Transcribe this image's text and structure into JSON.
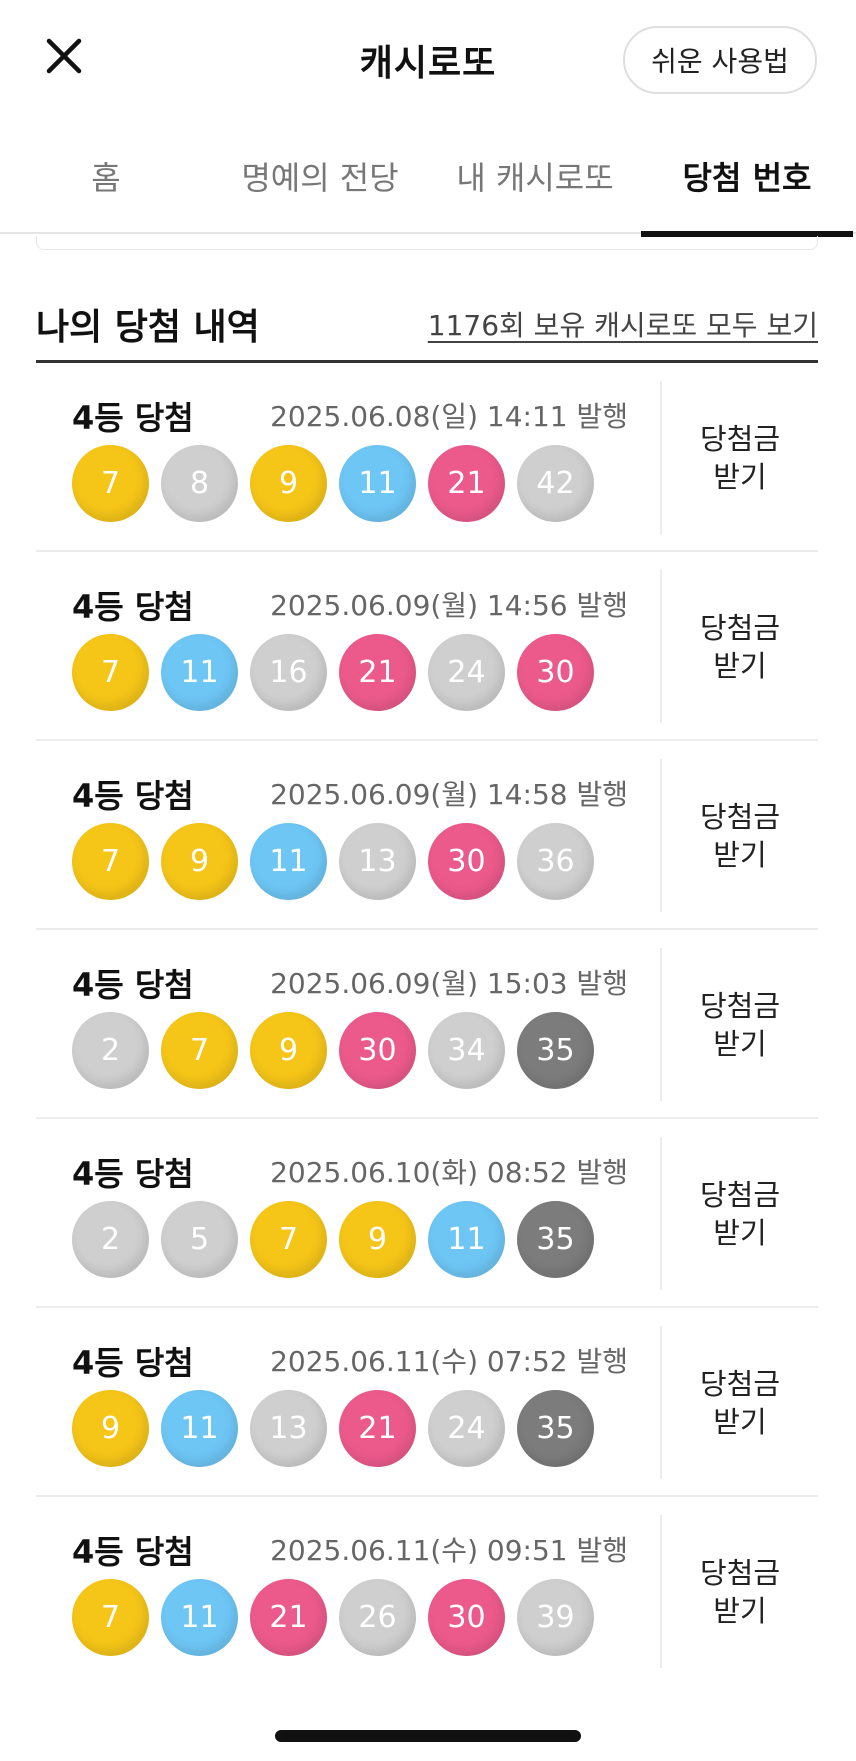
{
  "header": {
    "close_icon": "close-icon",
    "title": "캐시로또",
    "guide_label": "쉬운 사용법"
  },
  "tabs": [
    {
      "label": "홈",
      "active": false
    },
    {
      "label": "명예의 전당",
      "active": false
    },
    {
      "label": "내 캐시로또",
      "active": false
    },
    {
      "label": "당첨 번호",
      "active": true
    }
  ],
  "section": {
    "title": "나의 당첨 내역",
    "view_all_label": "1176회 보유 캐시로또 모두 보기"
  },
  "ball_colors": {
    "yellow": "#f5c518",
    "blue": "#6ec6f5",
    "pink": "#ec5a8c",
    "gray": "#cfcfcf",
    "dark": "#7c7c7c"
  },
  "entries": [
    {
      "rank": "4등 당첨",
      "date": "2025.06.08(일) 14:11 발행",
      "claim_line1": "당첨금",
      "claim_line2": "받기",
      "balls": [
        {
          "num": "7",
          "color": "yellow"
        },
        {
          "num": "8",
          "color": "gray"
        },
        {
          "num": "9",
          "color": "yellow"
        },
        {
          "num": "11",
          "color": "blue"
        },
        {
          "num": "21",
          "color": "pink"
        },
        {
          "num": "42",
          "color": "gray"
        }
      ]
    },
    {
      "rank": "4등 당첨",
      "date": "2025.06.09(월) 14:56 발행",
      "claim_line1": "당첨금",
      "claim_line2": "받기",
      "balls": [
        {
          "num": "7",
          "color": "yellow"
        },
        {
          "num": "11",
          "color": "blue"
        },
        {
          "num": "16",
          "color": "gray"
        },
        {
          "num": "21",
          "color": "pink"
        },
        {
          "num": "24",
          "color": "gray"
        },
        {
          "num": "30",
          "color": "pink"
        }
      ]
    },
    {
      "rank": "4등 당첨",
      "date": "2025.06.09(월) 14:58 발행",
      "claim_line1": "당첨금",
      "claim_line2": "받기",
      "balls": [
        {
          "num": "7",
          "color": "yellow"
        },
        {
          "num": "9",
          "color": "yellow"
        },
        {
          "num": "11",
          "color": "blue"
        },
        {
          "num": "13",
          "color": "gray"
        },
        {
          "num": "30",
          "color": "pink"
        },
        {
          "num": "36",
          "color": "gray"
        }
      ]
    },
    {
      "rank": "4등 당첨",
      "date": "2025.06.09(월) 15:03 발행",
      "claim_line1": "당첨금",
      "claim_line2": "받기",
      "balls": [
        {
          "num": "2",
          "color": "gray"
        },
        {
          "num": "7",
          "color": "yellow"
        },
        {
          "num": "9",
          "color": "yellow"
        },
        {
          "num": "30",
          "color": "pink"
        },
        {
          "num": "34",
          "color": "gray"
        },
        {
          "num": "35",
          "color": "dark"
        }
      ]
    },
    {
      "rank": "4등 당첨",
      "date": "2025.06.10(화) 08:52 발행",
      "claim_line1": "당첨금",
      "claim_line2": "받기",
      "balls": [
        {
          "num": "2",
          "color": "gray"
        },
        {
          "num": "5",
          "color": "gray"
        },
        {
          "num": "7",
          "color": "yellow"
        },
        {
          "num": "9",
          "color": "yellow"
        },
        {
          "num": "11",
          "color": "blue"
        },
        {
          "num": "35",
          "color": "dark"
        }
      ]
    },
    {
      "rank": "4등 당첨",
      "date": "2025.06.11(수) 07:52 발행",
      "claim_line1": "당첨금",
      "claim_line2": "받기",
      "balls": [
        {
          "num": "9",
          "color": "yellow"
        },
        {
          "num": "11",
          "color": "blue"
        },
        {
          "num": "13",
          "color": "gray"
        },
        {
          "num": "21",
          "color": "pink"
        },
        {
          "num": "24",
          "color": "gray"
        },
        {
          "num": "35",
          "color": "dark"
        }
      ]
    },
    {
      "rank": "4등 당첨",
      "date": "2025.06.11(수) 09:51 발행",
      "claim_line1": "당첨금",
      "claim_line2": "받기",
      "balls": [
        {
          "num": "7",
          "color": "yellow"
        },
        {
          "num": "11",
          "color": "blue"
        },
        {
          "num": "21",
          "color": "pink"
        },
        {
          "num": "26",
          "color": "gray"
        },
        {
          "num": "30",
          "color": "pink"
        },
        {
          "num": "39",
          "color": "gray"
        }
      ]
    }
  ]
}
